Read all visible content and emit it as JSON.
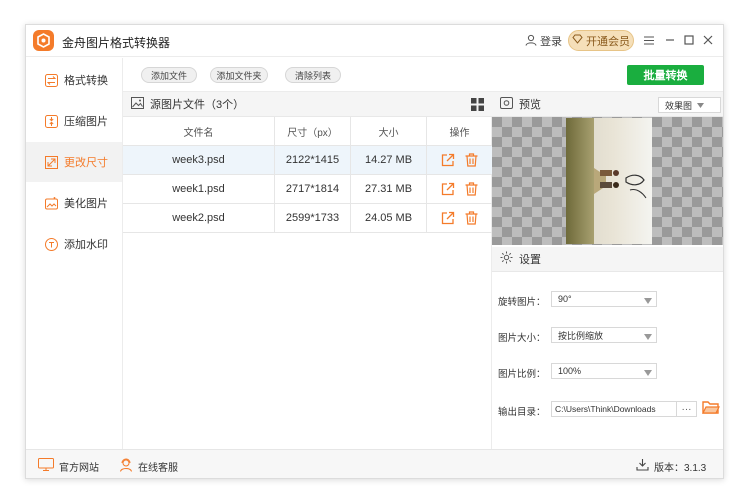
{
  "app": {
    "title": "金舟图片格式转换器",
    "accent": "#f47b2a",
    "green": "#1aae3f"
  },
  "titlebar": {
    "login": "登录",
    "vip": "开通会员"
  },
  "sidebar": {
    "items": [
      {
        "label": "格式转换",
        "icon": "convert-icon"
      },
      {
        "label": "压缩图片",
        "icon": "compress-icon"
      },
      {
        "label": "更改尺寸",
        "icon": "resize-icon",
        "active": true
      },
      {
        "label": "美化图片",
        "icon": "beautify-icon"
      },
      {
        "label": "添加水印",
        "icon": "watermark-icon"
      }
    ]
  },
  "toolbar": {
    "add_file": "添加文件",
    "add_folder": "添加文件夹",
    "clear_list": "清除列表",
    "batch_convert": "批量转换"
  },
  "files": {
    "header": "源图片文件（3个）",
    "columns": [
      "文件名",
      "尺寸（px）",
      "大小",
      "操作"
    ],
    "rows": [
      {
        "name": "week3.psd",
        "dims": "2122*1415",
        "size": "14.27 MB"
      },
      {
        "name": "week1.psd",
        "dims": "2717*1814",
        "size": "27.31 MB"
      },
      {
        "name": "week2.psd",
        "dims": "2599*1733",
        "size": "24.05 MB"
      }
    ]
  },
  "preview": {
    "title": "预览",
    "mode": "效果图"
  },
  "settings": {
    "title": "设置",
    "rotate_label": "旋转图片：",
    "rotate_value": "90°",
    "size_label": "图片大小：",
    "size_value": "按比例缩放",
    "ratio_label": "图片比例：",
    "ratio_value": "100%",
    "output_label": "输出目录：",
    "output_value": "C:\\Users\\Think\\Downloads",
    "more": "···"
  },
  "footer": {
    "website": "官方网站",
    "service": "在线客服",
    "version": "版本：3.1.3"
  }
}
